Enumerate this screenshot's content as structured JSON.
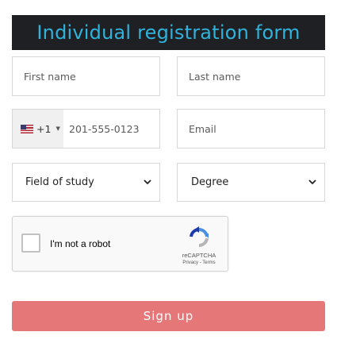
{
  "header": {
    "title": "Individual registration form"
  },
  "form": {
    "first_name_placeholder": "First name",
    "last_name_placeholder": "Last name",
    "phone_dial_code": "+1",
    "phone_placeholder": "201-555-0123",
    "email_placeholder": "Email",
    "field_of_study_selected": "Field of study",
    "degree_selected": "Degree",
    "phone_country_icon": "us-flag-icon"
  },
  "captcha": {
    "label": "I'm not a robot",
    "brand": "reCAPTCHA",
    "links": "Privacy - Terms"
  },
  "actions": {
    "signup_label": "Sign up"
  },
  "colors": {
    "title_bg": "#1f2024",
    "title_text": "#2fb3dc",
    "signup_bg": "#e57779"
  }
}
